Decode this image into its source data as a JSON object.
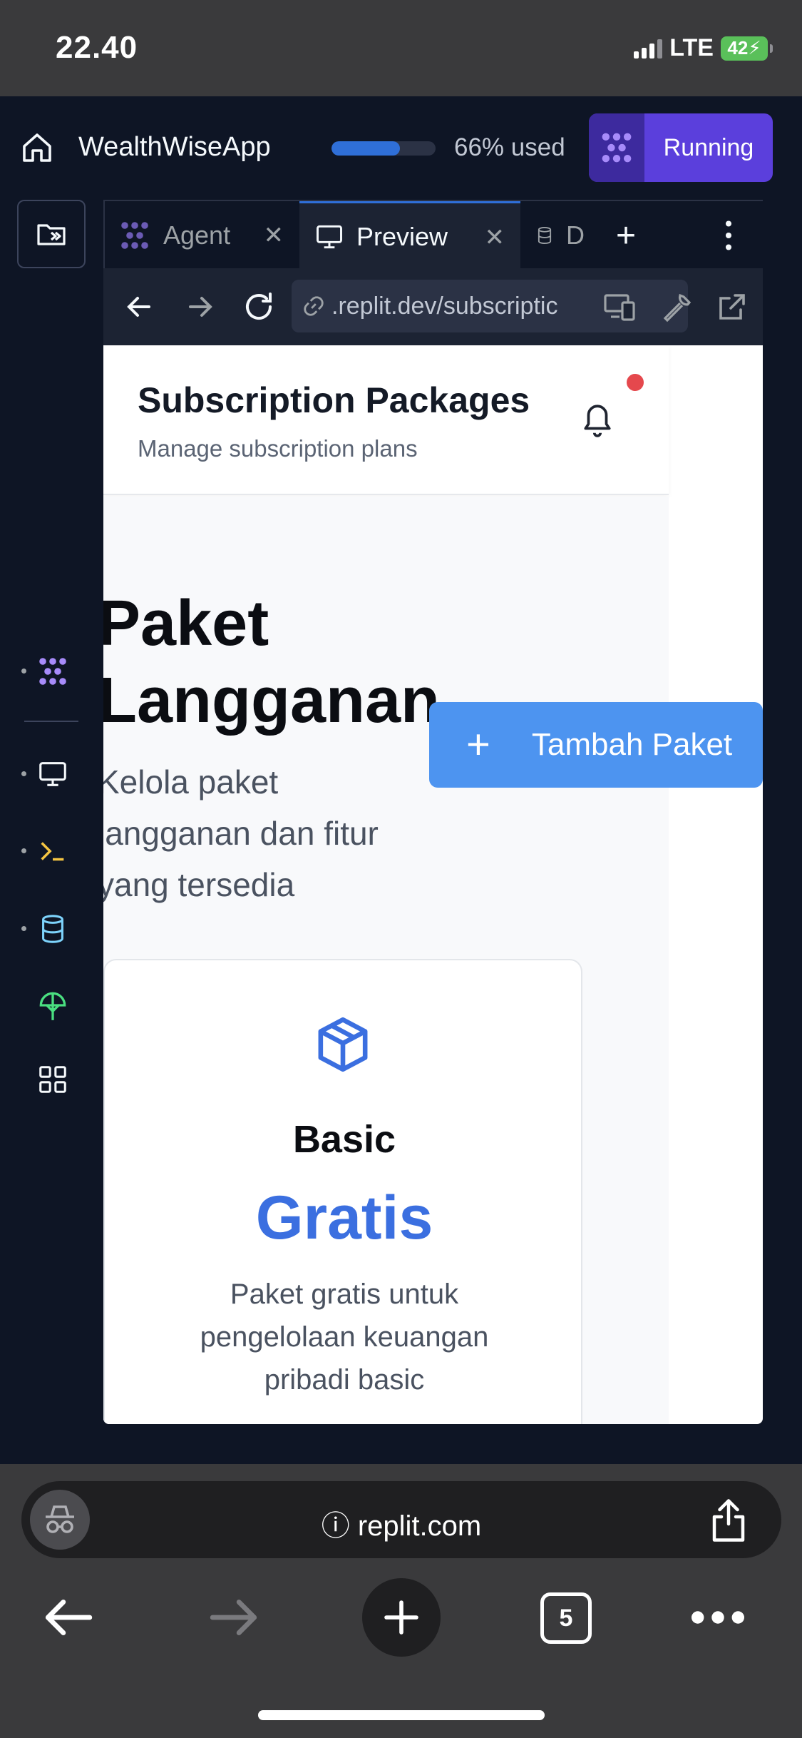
{
  "status_bar": {
    "time": "22.40",
    "network": "LTE",
    "battery": "42"
  },
  "app_bar": {
    "app_name": "WealthWiseApp",
    "usage_fraction": 0.66,
    "usage_text": "66% used",
    "run_label": "Running"
  },
  "tabs": {
    "agent_label": "Agent",
    "preview_label": "Preview",
    "database_label": "D"
  },
  "url_bar": {
    "url": ".replit.dev/subscriptic"
  },
  "preview": {
    "header_title": "Subscription Packages",
    "header_subtitle": "Manage subscription plans",
    "page_title": "Paket Langganan",
    "page_description": "Kelola paket langganan dan fitur yang tersedia",
    "add_button_label": "Tambah Paket",
    "card": {
      "name": "Basic",
      "price": "Gratis",
      "description": "Paket gratis untuk pengelolaan keuangan pribadi basic"
    }
  },
  "safari": {
    "domain": "replit.com",
    "tab_count": "5"
  },
  "colors": {
    "accent": "#5b3fdc",
    "primary_blue": "#4d94f0",
    "price_blue": "#3b6fe0"
  }
}
